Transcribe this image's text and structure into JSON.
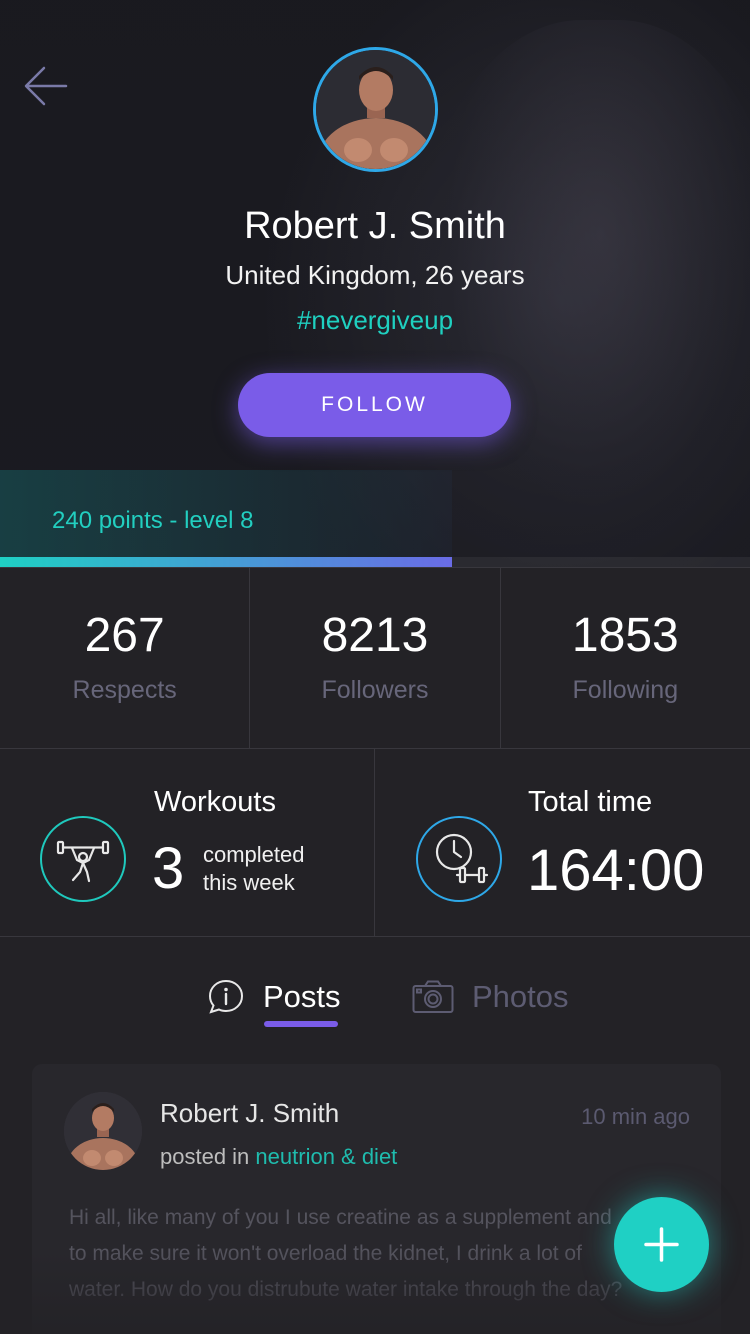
{
  "profile": {
    "name": "Robert J. Smith",
    "location_age": "United Kingdom, 26 years",
    "hashtag": "#nevergiveup",
    "follow_label": "FOLLOW",
    "points_level": "240 points  - level 8",
    "level_progress": 0.603
  },
  "stats": [
    {
      "value": "267",
      "label": "Respects"
    },
    {
      "value": "8213",
      "label": "Followers"
    },
    {
      "value": "1853",
      "label": "Following"
    }
  ],
  "workouts": {
    "title": "Workouts",
    "count": "3",
    "line1": "completed",
    "line2": "this week"
  },
  "total_time": {
    "title": "Total time",
    "value": "164:00"
  },
  "tabs": [
    {
      "label": "Posts",
      "active": true
    },
    {
      "label": "Photos",
      "active": false
    }
  ],
  "post": {
    "author": "Robert J. Smith",
    "time": "10 min ago",
    "posted_in": "posted in",
    "category": "neutrion & diet",
    "body": "Hi all, like many of you I use creatine as a supplement and to make sure it won't overload the kidnet, I drink a lot of water. How do you distrubute water intake through the day?"
  },
  "colors": {
    "accent_teal": "#1fd0c4",
    "accent_purple": "#7a5ce8",
    "avatar_ring": "#2ea8e8",
    "background": "#232226"
  },
  "icons": {
    "back": "arrow-left-icon",
    "workout": "weightlifter-icon",
    "time": "clock-dumbbell-icon",
    "posts": "info-bubble-icon",
    "photos": "camera-icon",
    "fab": "plus-icon"
  }
}
